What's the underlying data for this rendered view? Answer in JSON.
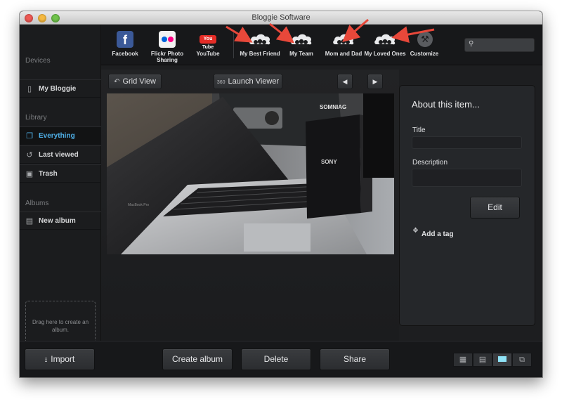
{
  "window": {
    "title": "Bloggie Software"
  },
  "sidebar": {
    "sections": [
      {
        "heading": "Devices",
        "items": [
          {
            "label": "My Bloggie",
            "icon": "phone-icon",
            "active": false
          }
        ]
      },
      {
        "heading": "Library",
        "items": [
          {
            "label": "Everything",
            "icon": "stack-icon",
            "active": true
          },
          {
            "label": "Last viewed",
            "icon": "history-icon",
            "active": false
          },
          {
            "label": "Trash",
            "icon": "trash-icon",
            "active": false
          }
        ]
      },
      {
        "heading": "Albums",
        "items": [
          {
            "label": "New album",
            "icon": "album-icon",
            "active": false
          }
        ]
      }
    ],
    "drop_zone": "Drag here to create an album."
  },
  "share_bar": {
    "services": [
      {
        "label": "Facebook",
        "icon": "facebook-icon"
      },
      {
        "label": "Flickr Photo Sharing",
        "icon": "flickr-icon"
      },
      {
        "label": "YouTube",
        "icon": "youtube-icon",
        "icon_text": "You Tube"
      }
    ],
    "groups": [
      {
        "label": "My Best Friend",
        "icon": "cloud-people-icon"
      },
      {
        "label": "My Team",
        "icon": "cloud-people-icon"
      },
      {
        "label": "Mom and Dad",
        "icon": "cloud-people-icon"
      },
      {
        "label": "My Loved Ones",
        "icon": "cloud-people-icon"
      }
    ],
    "customize": {
      "label": "Customize",
      "icon": "wrench-icon"
    },
    "search": {
      "placeholder": "",
      "value": ""
    }
  },
  "view_bar": {
    "grid_view": "Grid View",
    "launch_viewer": "Launch Viewer",
    "launch_badge": "360",
    "prev_icon": "triangle-left-icon",
    "next_icon": "triangle-right-icon"
  },
  "photo": {
    "box_brand": "SONY",
    "laptop_label": "MacBook Pro",
    "poster_text": "SOMNIAG"
  },
  "about": {
    "title": "About this item...",
    "title_label": "Title",
    "title_value": "",
    "description_label": "Description",
    "description_value": "",
    "edit_label": "Edit",
    "add_tag_label": "Add a tag"
  },
  "bottom_bar": {
    "import": "Import",
    "create_album": "Create album",
    "delete": "Delete",
    "share": "Share",
    "view_modes": [
      "grid-mode-icon",
      "list-mode-icon",
      "single-mode-icon",
      "slideshow-mode-icon"
    ],
    "active_view_mode": 2
  },
  "colors": {
    "accent": "#4fb0e8",
    "annotation_arrow": "#e8483a",
    "window_bg": "#1d1e20"
  }
}
